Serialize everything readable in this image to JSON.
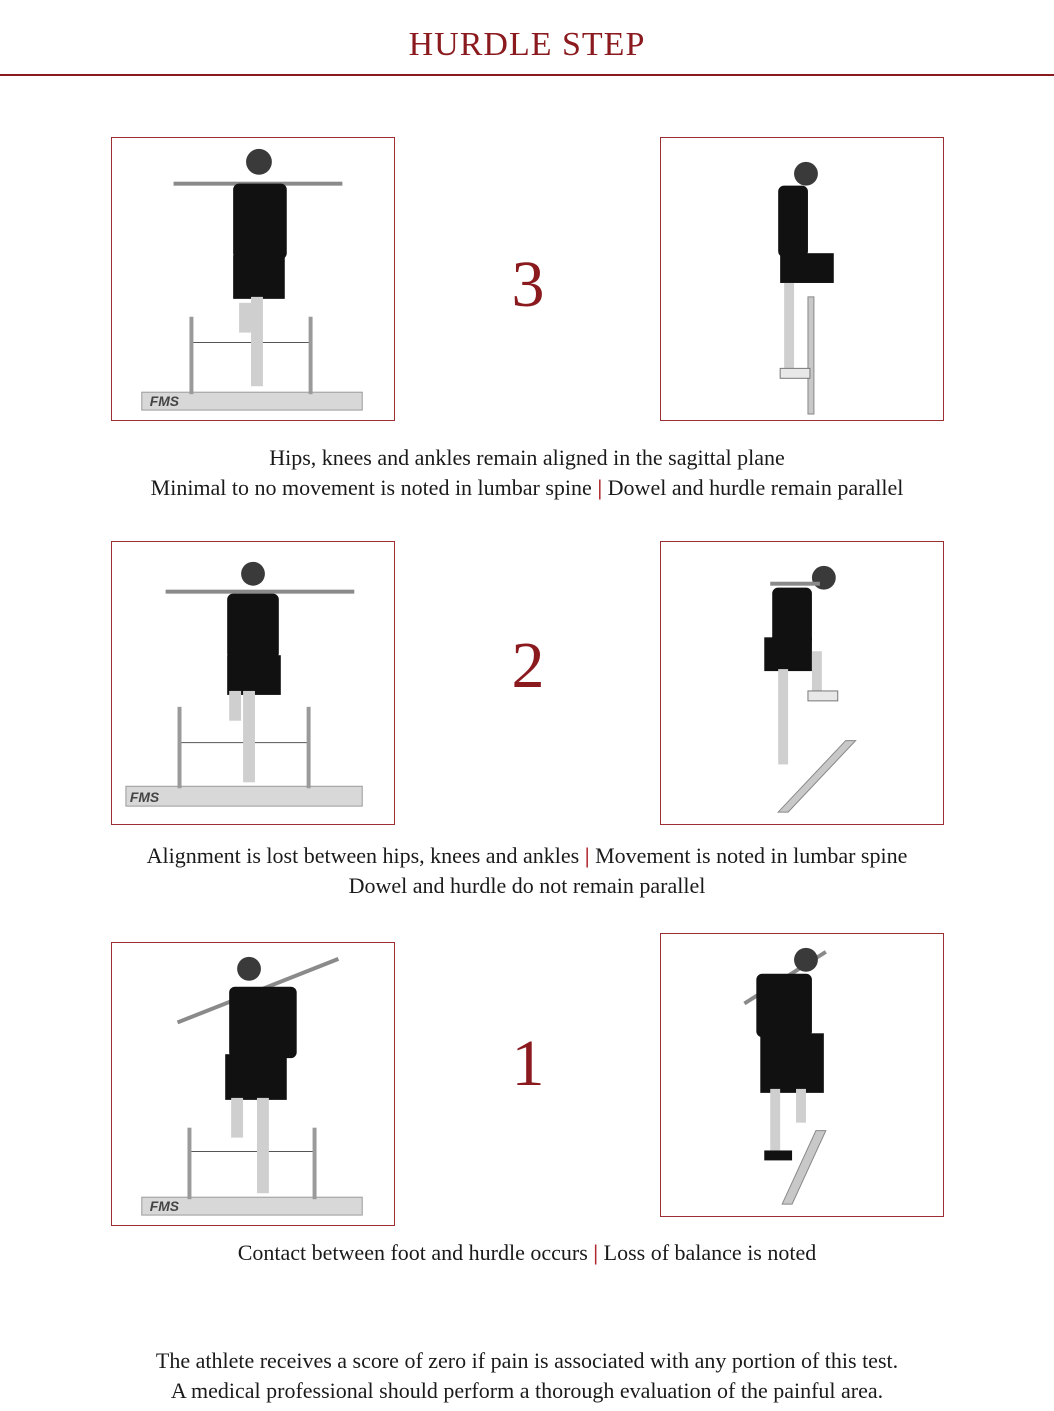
{
  "page": {
    "title": "HURDLE STEP"
  },
  "accent_color": "#8b1a1f",
  "rows": [
    {
      "score": "3",
      "front_photo": {
        "logo_text": "FMS"
      },
      "caption": {
        "line1_part1": "Hips, knees and ankles remain aligned in the sagittal plane",
        "line2_part1": "Minimal to no movement is noted in lumbar spine",
        "separator": "|",
        "line2_part2": "Dowel and hurdle remain parallel"
      }
    },
    {
      "score": "2",
      "front_photo": {
        "logo_text": "FMS"
      },
      "caption": {
        "line1_part1": "Alignment is lost between hips, knees and ankles",
        "separator": "|",
        "line1_part2": "Movement is noted in lumbar spine",
        "line2_part1": "Dowel and hurdle do not remain parallel"
      }
    },
    {
      "score": "1",
      "front_photo": {
        "logo_text": "FMS"
      },
      "caption": {
        "line1_part1": "Contact between foot and hurdle occurs",
        "separator": "|",
        "line1_part2": "Loss of balance is noted"
      }
    }
  ],
  "footer": {
    "line1": "The athlete receives a score of zero if pain is associated with any portion of this test.",
    "line2": "A medical professional should perform a thorough evaluation of the painful area."
  }
}
